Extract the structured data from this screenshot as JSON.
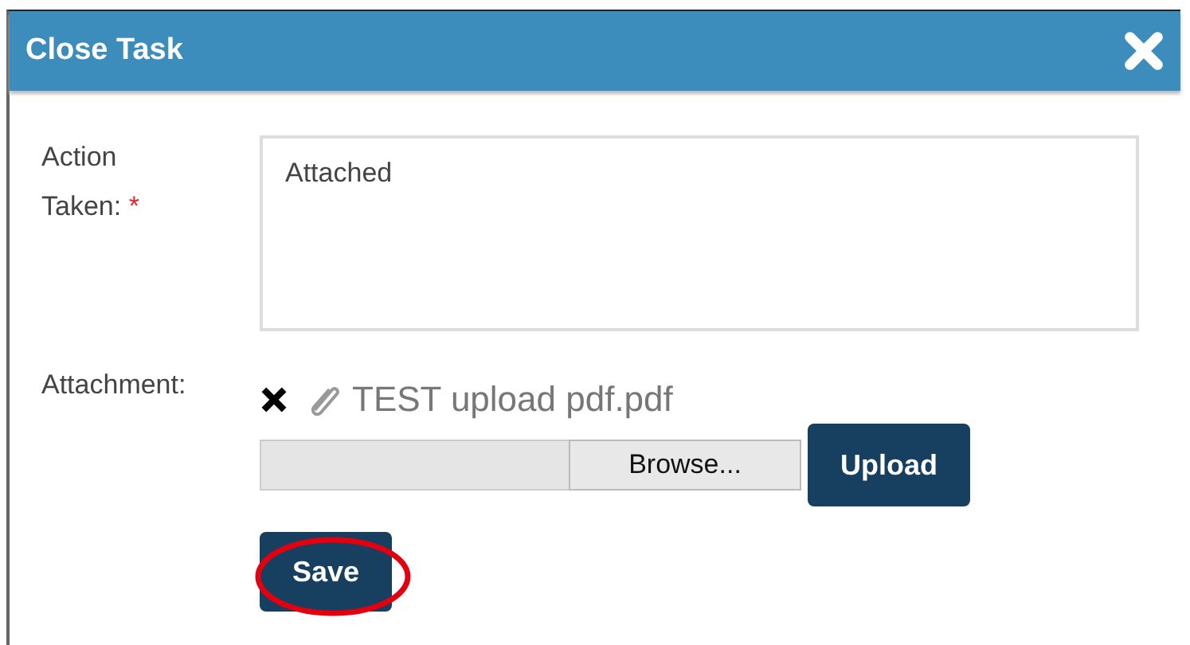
{
  "dialog": {
    "title": "Close Task"
  },
  "action_taken": {
    "label": "Action\nTaken:",
    "required_mark": "*",
    "value": "Attached"
  },
  "attachment": {
    "label": "Attachment:",
    "file_name": "TEST upload pdf.pdf",
    "browse_label": "Browse...",
    "upload_label": "Upload"
  },
  "save_button": {
    "label": "Save",
    "highlighted": true
  }
}
